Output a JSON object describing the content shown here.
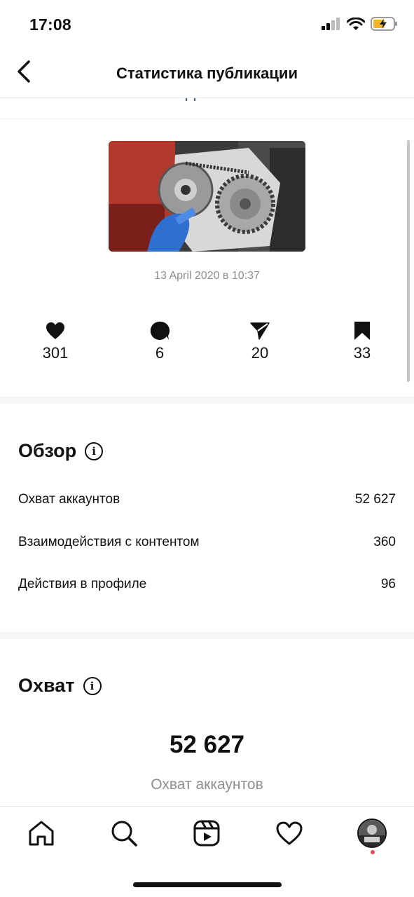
{
  "status_bar": {
    "time": "17:08",
    "icons": [
      "signal-icon",
      "wifi-icon",
      "battery-charging-icon"
    ]
  },
  "header": {
    "title": "Статистика публикации",
    "back_icon": "chevron-left-icon"
  },
  "post": {
    "date": "13 April 2020 в 10:37",
    "thumbnail": "engine-timing-chain-photo"
  },
  "metrics": [
    {
      "icon": "heart-icon",
      "value": "301"
    },
    {
      "icon": "comment-icon",
      "value": "6"
    },
    {
      "icon": "share-icon",
      "value": "20"
    },
    {
      "icon": "bookmark-icon",
      "value": "33"
    }
  ],
  "overview": {
    "title": "Обзор",
    "rows": [
      {
        "label": "Охват аккаунтов",
        "value": "52 627"
      },
      {
        "label": "Взаимодействия с контентом",
        "value": "360"
      },
      {
        "label": "Действия в профиле",
        "value": "96"
      }
    ]
  },
  "reach": {
    "title": "Охват",
    "value": "52 627",
    "label": "Охват аккаунтов"
  },
  "tab_bar": {
    "tabs": [
      "home-icon",
      "search-icon",
      "reels-icon",
      "activity-heart-icon",
      "profile-avatar"
    ]
  },
  "colors": {
    "text": "#111111",
    "secondary": "#8e8e8e",
    "notification": "#ed4956"
  }
}
